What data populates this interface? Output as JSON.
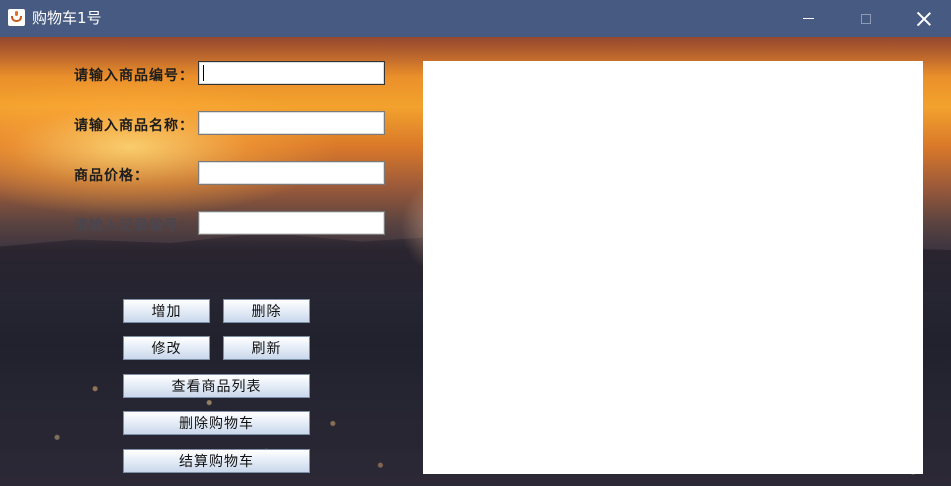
{
  "window": {
    "title": "购物车1号",
    "icon": "java-cup-icon",
    "controls": {
      "minimize": "minimize-icon",
      "maximize": "maximize-icon",
      "close": "close-icon"
    }
  },
  "form": {
    "product_id": {
      "label": "请输入商品编号：",
      "value": ""
    },
    "product_name": {
      "label": "请输入商品名称：",
      "value": ""
    },
    "price": {
      "label": "商品价格：",
      "value": ""
    },
    "record_id": {
      "label": "请输入记录编号：",
      "value": ""
    }
  },
  "buttons": {
    "add": "增加",
    "delete": "删除",
    "modify": "修改",
    "refresh": "刷新",
    "view_list": "查看商品列表",
    "clear_cart": "删除购物车",
    "checkout": "结算购物车"
  },
  "list_panel": {
    "items": []
  },
  "colors": {
    "titlebar": "#475b82",
    "button_gradient_bottom": "#c9d8ec"
  }
}
